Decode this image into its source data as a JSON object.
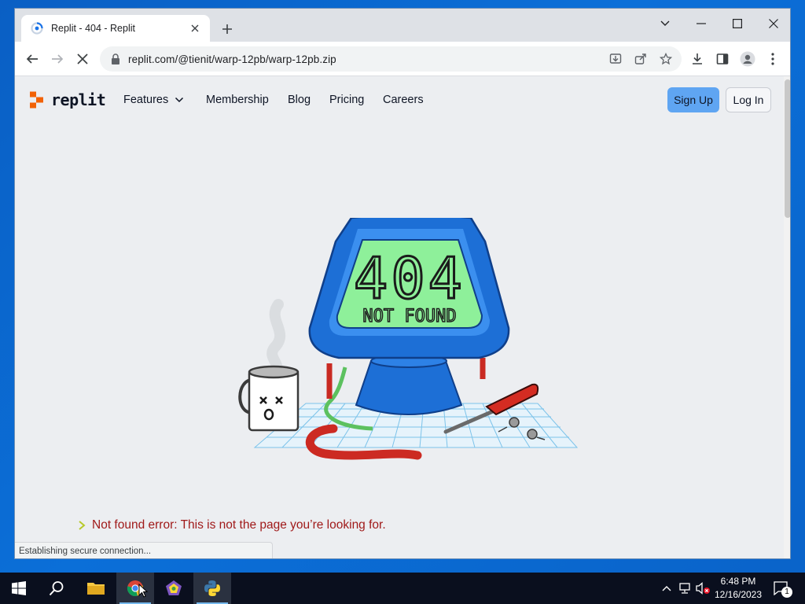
{
  "browser": {
    "tab_title": "Replit - 404 - Replit",
    "url": "replit.com/@tienit/warp-12pb/warp-12pb.zip",
    "status_text": "Establishing secure connection..."
  },
  "site": {
    "logo_text": "replit",
    "nav": {
      "features": "Features",
      "membership": "Membership",
      "blog": "Blog",
      "pricing": "Pricing",
      "careers": "Careers"
    },
    "sign_up": "Sign Up",
    "log_in": "Log In"
  },
  "error": {
    "digits": "404",
    "screen_label": "NOT FOUND",
    "message": "Not found error: This is not the page you’re looking for."
  },
  "taskbar": {
    "time": "6:48 PM",
    "date": "12/16/2023",
    "notification_count": "1"
  },
  "colors": {
    "brand_orange": "#f26207",
    "signup_blue": "#5fa5f2",
    "screen_green": "#8ef09a",
    "device_blue": "#1d6fd6",
    "error_red": "#a01a1a"
  }
}
